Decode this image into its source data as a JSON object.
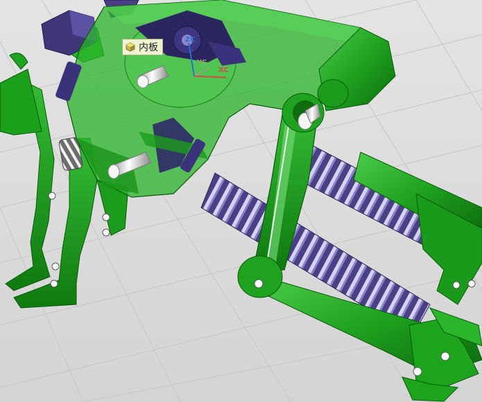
{
  "viewport": {
    "tooltip": {
      "label": "内板",
      "icon": "part-cube-icon"
    },
    "triad": {
      "z_label": "ZC",
      "y_label": "YC",
      "x_label": "XC",
      "colors": {
        "z": "#2b6fd6",
        "y": "#9aa07a",
        "x": "#d24a4a"
      }
    }
  },
  "colors": {
    "part_green": "#1fa21f",
    "part_green_dark": "#0c6b0c",
    "part_green_light": "#4ccc4c",
    "transparent_green": "#3fcf3f",
    "spring": "#5a4f96",
    "spring_light": "#c9c6ee",
    "pin": "#e8e8e8",
    "block": "#4a3f86",
    "grid": "#c7c7c7"
  }
}
